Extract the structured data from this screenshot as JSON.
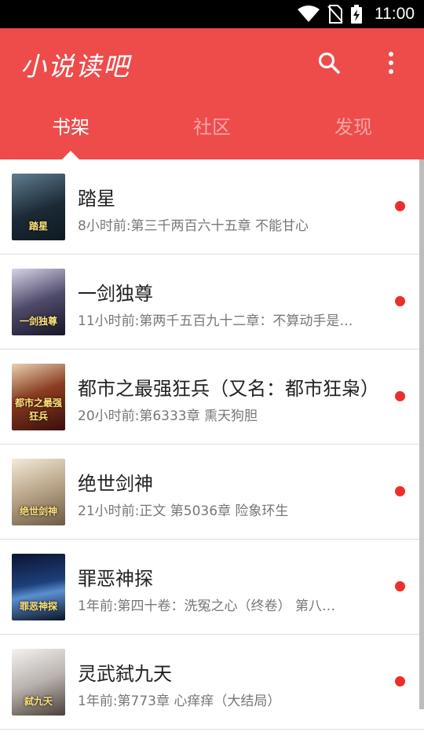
{
  "status_bar": {
    "time": "11:00"
  },
  "app_bar": {
    "title": "小说读吧"
  },
  "tabs": [
    {
      "label": "书架",
      "active": true
    },
    {
      "label": "社区",
      "active": false
    },
    {
      "label": "发现",
      "active": false
    }
  ],
  "books": [
    {
      "title": "踏星",
      "update": "8小时前:第三千两百六十五章  不能甘心",
      "cover_text": "踏星",
      "unread": true
    },
    {
      "title": "一剑独尊",
      "update": "11小时前:第两千五百九十二章：不算动手是…",
      "cover_text": "一剑独尊",
      "unread": true
    },
    {
      "title": "都市之最强狂兵（又名：都市狂枭）",
      "update": "20小时前:第6333章 熏天狗胆",
      "cover_text": "都市之最强狂兵",
      "unread": true
    },
    {
      "title": "绝世剑神",
      "update": "21小时前:正文 第5036章 险象环生",
      "cover_text": "绝世剑神",
      "unread": true
    },
    {
      "title": "罪恶神探",
      "update": "1年前:第四十卷：洗冤之心（终卷） 第八…",
      "cover_text": "罪恶神探",
      "unread": true
    },
    {
      "title": "灵武弑九天",
      "update": "1年前:第773章 心痒痒（大结局）",
      "cover_text": "弑九天",
      "unread": true
    }
  ],
  "colors": {
    "primary": "#ee4b4b",
    "unread_dot": "#ee2e2e",
    "inactive_tab": "#f5a5a5"
  }
}
